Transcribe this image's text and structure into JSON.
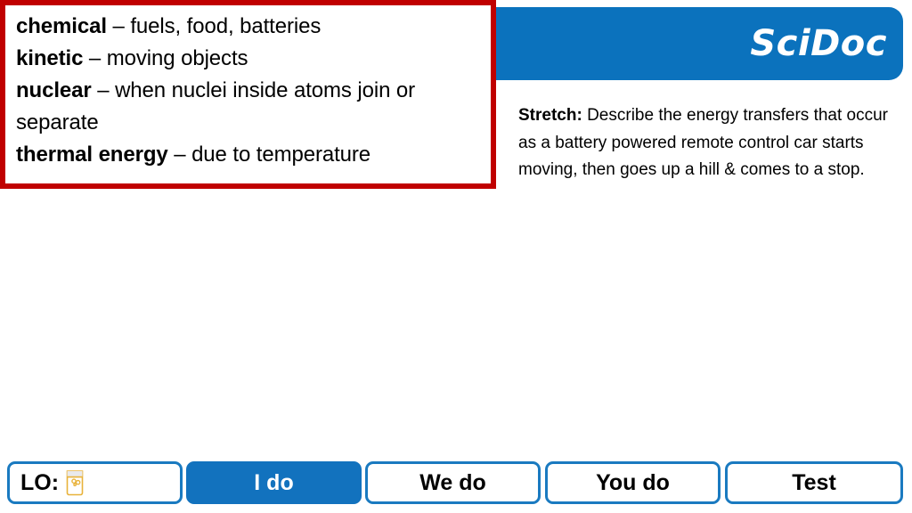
{
  "brand": {
    "wordmark": "SciDoc",
    "banner_color": "#0b72bd"
  },
  "definitions": {
    "border_color": "#c00000",
    "items": [
      {
        "term": "chemical",
        "separator": " – ",
        "description": "fuels, food, batteries"
      },
      {
        "term": "kinetic",
        "separator": " – ",
        "description": "moving objects"
      },
      {
        "term": "nuclear",
        "separator": " – ",
        "description": "when nuclei inside atoms join or separate"
      },
      {
        "term": "thermal energy",
        "separator": " – ",
        "description": "due to temperature"
      }
    ]
  },
  "stretch": {
    "label": "Stretch:",
    "body": " Describe the energy transfers that occur as a battery powered remote control car starts moving, then goes up a hill & comes to a stop."
  },
  "nav": {
    "accent_color": "#1a7ac0",
    "active_color": "#1272be",
    "lo_label": "LO:",
    "lo_icon": "beaker-icon",
    "buttons": [
      {
        "label": "I do",
        "active": true
      },
      {
        "label": "We do",
        "active": false
      },
      {
        "label": "You do",
        "active": false
      },
      {
        "label": "Test",
        "active": false
      }
    ]
  }
}
